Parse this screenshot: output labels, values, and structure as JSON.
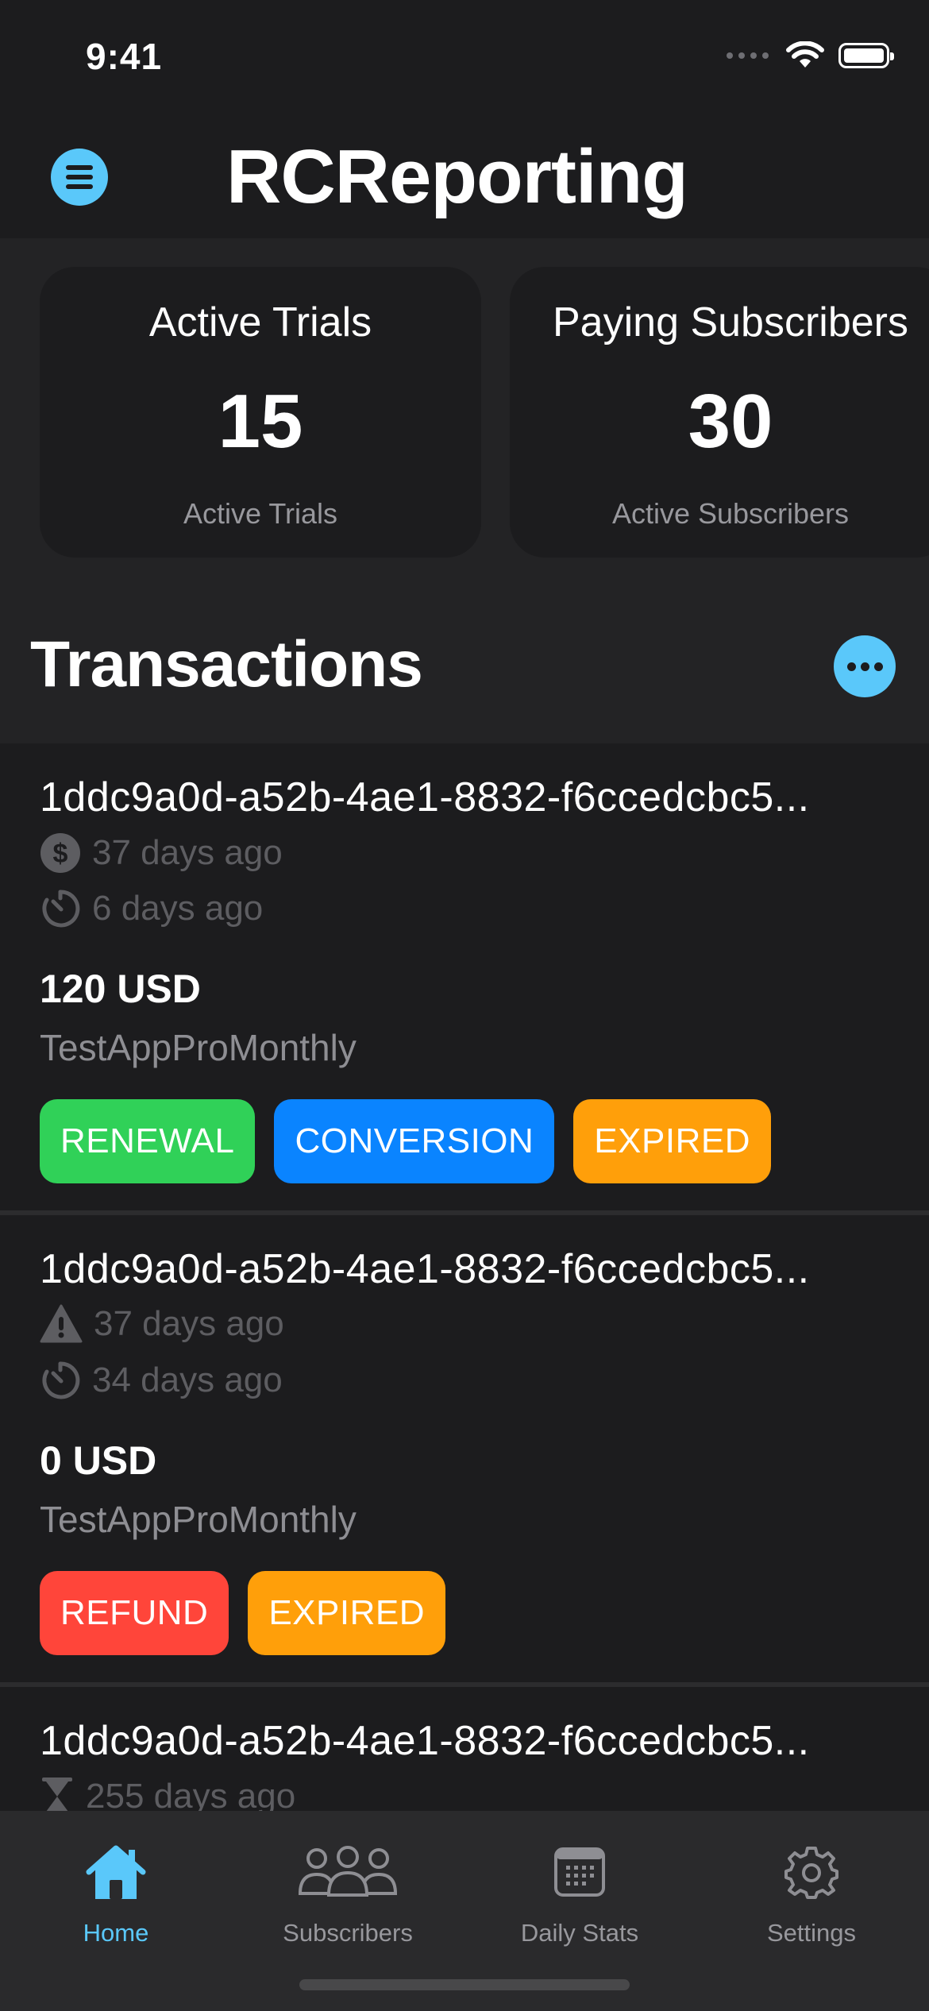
{
  "status_bar": {
    "time": "9:41"
  },
  "nav": {
    "title": "RCReporting"
  },
  "summary_cards": [
    {
      "title": "Active Trials",
      "value": "15",
      "subtitle": "Active Trials"
    },
    {
      "title": "Paying Subscribers",
      "value": "30",
      "subtitle": "Active Subscribers"
    }
  ],
  "transactions_section": {
    "title": "Transactions"
  },
  "transactions": [
    {
      "id": "1ddc9a0d-a52b-4ae1-8832-f6ccedcbc5...",
      "meta1": {
        "icon": "dollar-circle-icon",
        "text": "37 days ago"
      },
      "meta2": {
        "icon": "timer-icon",
        "text": "6 days ago"
      },
      "amount": "120 USD",
      "product": "TestAppProMonthly",
      "tags": [
        {
          "label": "RENEWAL",
          "color": "#30d158"
        },
        {
          "label": "CONVERSION",
          "color": "#0a84ff"
        },
        {
          "label": "EXPIRED",
          "color": "#ff9f0a"
        }
      ]
    },
    {
      "id": "1ddc9a0d-a52b-4ae1-8832-f6ccedcbc5...",
      "meta1": {
        "icon": "warning-icon",
        "text": "37 days ago"
      },
      "meta2": {
        "icon": "timer-icon",
        "text": "34 days ago"
      },
      "amount": "0 USD",
      "product": "TestAppProMonthly",
      "tags": [
        {
          "label": "REFUND",
          "color": "#ff453a"
        },
        {
          "label": "EXPIRED",
          "color": "#ff9f0a"
        }
      ]
    },
    {
      "id": "1ddc9a0d-a52b-4ae1-8832-f6ccedcbc5...",
      "meta1": {
        "icon": "hourglass-icon",
        "text": "255 days ago"
      }
    }
  ],
  "tab_bar": {
    "tabs": [
      {
        "label": "Home",
        "icon": "house-icon",
        "active": true
      },
      {
        "label": "Subscribers",
        "icon": "people-icon",
        "active": false
      },
      {
        "label": "Daily Stats",
        "icon": "calendar-icon",
        "active": false
      },
      {
        "label": "Settings",
        "icon": "gear-icon",
        "active": false
      }
    ]
  },
  "colors": {
    "accent": "#5ac8fa",
    "background": "#1c1c1e",
    "renewal": "#30d158",
    "conversion": "#0a84ff",
    "expired": "#ff9f0a",
    "refund": "#ff453a"
  }
}
